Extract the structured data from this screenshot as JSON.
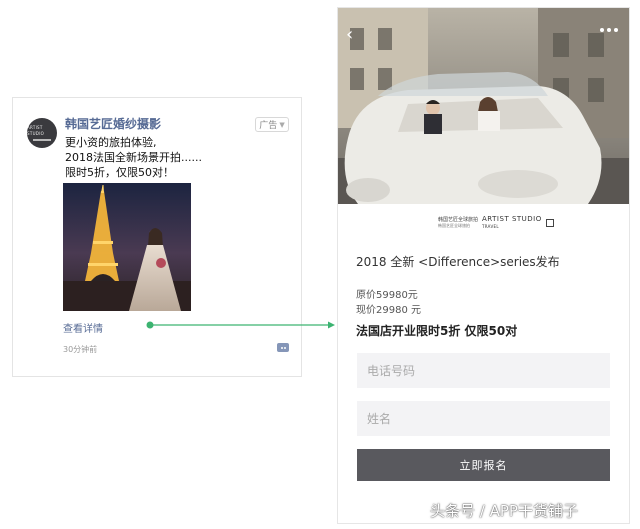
{
  "ad": {
    "account_name": "韩国艺匠婚纱摄影",
    "ad_tag": "广告",
    "avatar_text": "ARTIST STUDIO",
    "text_lines": [
      "更小资的旅拍体验,",
      "2018法国全新场景开拍......",
      "限时5折，仅限50对！"
    ],
    "details_link": "查看详情",
    "time": "30分钟前",
    "photo_icon": "eiffel-tower-bride-photo"
  },
  "landing": {
    "hero_icon": "wedding-car-photo",
    "brand": {
      "cn": "韩国艺匠全球旅拍",
      "cn_sub": "韩国艺匠全球旅拍",
      "en": "ARTIST STUDIO",
      "en_sub": "TRAVEL"
    },
    "series_title": "2018 全新 <Difference>series发布",
    "original_price": "原价59980元",
    "current_price": "现价29980 元",
    "promo": "法国店开业限时5折 仅限50对",
    "phone_placeholder": "电话号码",
    "name_placeholder": "姓名",
    "submit_label": "立即报名"
  },
  "watermark": "头条号 / APP干货铺子",
  "colors": {
    "link": "#576b95",
    "connector": "#3cb371",
    "button": "#59595e",
    "field_bg": "#f3f3f5"
  }
}
